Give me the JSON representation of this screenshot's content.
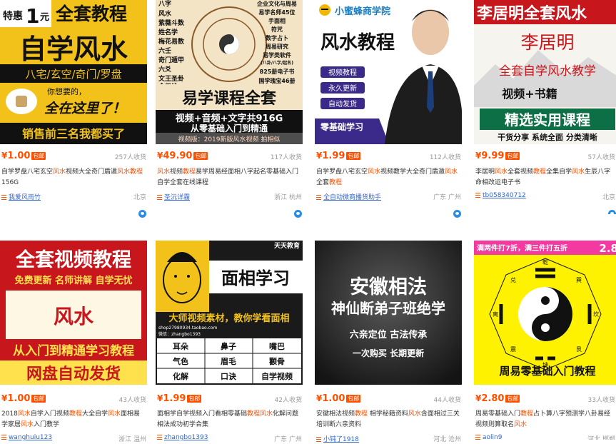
{
  "products": [
    {
      "price": "1.00",
      "badge": "包邮",
      "sold": "257人收货",
      "title_parts": [
        "自学罗盘八宅玄空",
        "风水",
        "视频大全奇门盾遁",
        "风水教程",
        "156G"
      ],
      "shop": "我爱风雨竹",
      "location": "北京",
      "thumb": {
        "t1a": "特惠",
        "t1b": "1",
        "t1c": "元",
        "t2": "全套教程",
        "t3": "自学风水",
        "t4": "八宅/玄空/奇门/罗盘",
        "t5": "你想要的，",
        "t6": "全在这里了！",
        "t7": "销售前三名我都买了"
      }
    },
    {
      "price": "49.90",
      "badge": "包邮",
      "sold": "117人收货",
      "title_parts": [
        "",
        "风水",
        "视频",
        "教程",
        "易学周易经面相八字起名零基础入门自学全套在线课程"
      ],
      "shop": "圣沅详霧",
      "location": "浙江 杭州",
      "thumb": {
        "left": [
          "八字",
          "风水",
          "紫薇斗数",
          "姓名学",
          "梅花易数",
          "六壬",
          "奇门遁甲",
          "六爻",
          "文王圣卦",
          "金口诀"
        ],
        "right": [
          "企业文化与周易",
          "易学名师45位",
          "手面相",
          "符咒",
          "数字占卜",
          "周易研究",
          "易学类软件",
          "(八卦/八字/起名)",
          "825册电子书",
          "国学瑰宝46册"
        ],
        "t1": "易学课程全套",
        "t2": "视频+音频+文字共916G",
        "t3": "从零基础入门到精通",
        "wm": "视频版：2019新版风水视频 拍相似"
      }
    },
    {
      "price": "1.99",
      "badge": "包邮",
      "sold": "112人收货",
      "title_parts": [
        "自学罗盘八宅玄空",
        "风水",
        "视频教学大全奇门盾遁",
        "风水",
        "全套",
        "教程",
        ""
      ],
      "shop": "全自动微商播货助手",
      "location": "广东 广州",
      "thumb": {
        "brand": "小蜜蜂商学院",
        "t1": "风水教程",
        "tags": [
          "视频教程",
          "永久更新",
          "自动发货"
        ],
        "t2": "零基础学习"
      }
    },
    {
      "price": "9.99",
      "badge": "包邮",
      "sold": "57人收货",
      "title_parts": [
        "李居明",
        "风水",
        "全套视频",
        "教程",
        "全集自学",
        "风水",
        "生辰八字命相改运电子书"
      ],
      "shop": "tb058340712",
      "location": "北京",
      "thumb": {
        "t1": "李居明全套风水",
        "t2": "李居明",
        "t3": "全套自学风水教学",
        "t4": "视频+书籍",
        "t5": "精选实用课程",
        "t6": "干货分享 系统全面 分类清晰"
      }
    },
    {
      "price": "1.00",
      "badge": "包邮",
      "sold": "43人收货",
      "title_parts": [
        "2018",
        "风水",
        "自学入门视频",
        "教程",
        "大全自学",
        "风水",
        "面相易学家居",
        "风水",
        "入门教学"
      ],
      "shop": "wanghuiu123",
      "location": "浙江 温州",
      "thumb": {
        "t1": "全套视频教程",
        "t2": "免费更新  名师讲解  自学无忧",
        "t3": "风水",
        "t4": "从入门到精通学习教程",
        "t5": "网盘自动发货"
      }
    },
    {
      "price": "1.99",
      "badge": "包邮",
      "sold": "42人收货",
      "title_parts": [
        "面相学自学视频入门看相零基础",
        "教程",
        "",
        "风水",
        "化解问题相法成功初学合集"
      ],
      "shop": "zhangbo1393",
      "location": "广东 广州",
      "thumb": {
        "corner": "天天教育",
        "t1": "面相学习",
        "t2": "大师视频素材，教你学看面相",
        "qq": "shop27980934.taobao.com",
        "wx": "微信：zhangbo1393",
        "grid": [
          "耳朵",
          "鼻子",
          "嘴巴",
          "气色",
          "眉毛",
          "颧骨",
          "化解",
          "口诀",
          "自学视频"
        ]
      }
    },
    {
      "price": "1.00",
      "badge": "包邮",
      "sold": "44人收货",
      "title_parts": [
        "安徽相法视频",
        "教程",
        " 相学秘籍资料",
        "风水",
        "含面相过三关培训断六亲资料"
      ],
      "shop": "小钝了1918",
      "location": "河北 沧州",
      "thumb": {
        "t1": "安徽相法",
        "t2": "神仙断弟子班绝学",
        "t3": "六亲定位  古法传承",
        "t4": "一次购买  长期更新"
      }
    },
    {
      "price": "2.80",
      "badge": "包邮",
      "sold": "33人收货",
      "title_parts": [
        "周易零基础入门",
        "教程",
        "占卜算八字预测学八卦易经视频则算取名",
        "风水",
        ""
      ],
      "shop": "aolin9",
      "location": "河北 邯郸",
      "thumb": {
        "banner": "满两件打7折，满三件打五折",
        "price": "2.8",
        "t1": "周易零基础入门教程",
        "trigrams": [
          "乾",
          "兑",
          "离",
          "震",
          "坤",
          "艮",
          "坎",
          "巽"
        ]
      }
    }
  ],
  "colors": {
    "accent": "#ff5000",
    "link": "#3366cc",
    "muted": "#999999",
    "wangwang": "#2b8ce5"
  }
}
